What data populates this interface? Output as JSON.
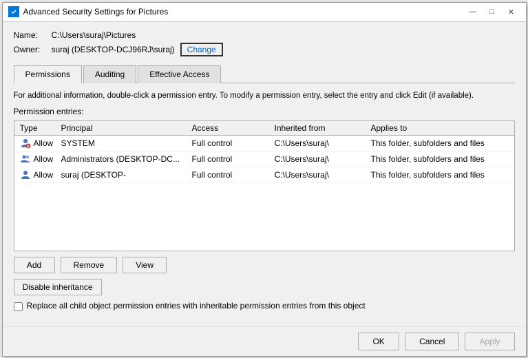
{
  "window": {
    "title": "Advanced Security Settings for Pictures",
    "icon": "🔒"
  },
  "title_bar": {
    "minimize": "—",
    "maximize": "□",
    "close": "✕"
  },
  "info": {
    "name_label": "Name:",
    "name_value": "C:\\Users\\suraj\\Pictures",
    "owner_label": "Owner:",
    "owner_value": "suraj (DESKTOP-DCJ96RJ\\suraj)",
    "change_btn": "Change"
  },
  "tabs": [
    {
      "label": "Permissions",
      "active": true
    },
    {
      "label": "Auditing",
      "active": false
    },
    {
      "label": "Effective Access",
      "active": false
    }
  ],
  "description": "For additional information, double-click a permission entry. To modify a permission entry, select the entry and click Edit (if available).",
  "section_label": "Permission entries:",
  "table": {
    "headers": [
      "Type",
      "Principal",
      "Access",
      "Inherited from",
      "Applies to"
    ],
    "rows": [
      {
        "type": "Allow",
        "principal": "SYSTEM",
        "access": "Full control",
        "inherited_from": "C:\\Users\\suraj\\",
        "applies_to": "This folder, subfolders and files"
      },
      {
        "type": "Allow",
        "principal": "Administrators (DESKTOP-DC...",
        "access": "Full control",
        "inherited_from": "C:\\Users\\suraj\\",
        "applies_to": "This folder, subfolders and files"
      },
      {
        "type": "Allow",
        "principal": "suraj (DESKTOP-",
        "access": "Full control",
        "inherited_from": "C:\\Users\\suraj\\",
        "applies_to": "This folder, subfolders and files"
      }
    ]
  },
  "action_buttons": {
    "add": "Add",
    "remove": "Remove",
    "view": "View"
  },
  "disable_btn": "Disable inheritance",
  "checkbox": {
    "label": "Replace all child object permission entries with inheritable permission entries from this object"
  },
  "dialog_buttons": {
    "ok": "OK",
    "cancel": "Cancel",
    "apply": "Apply"
  }
}
